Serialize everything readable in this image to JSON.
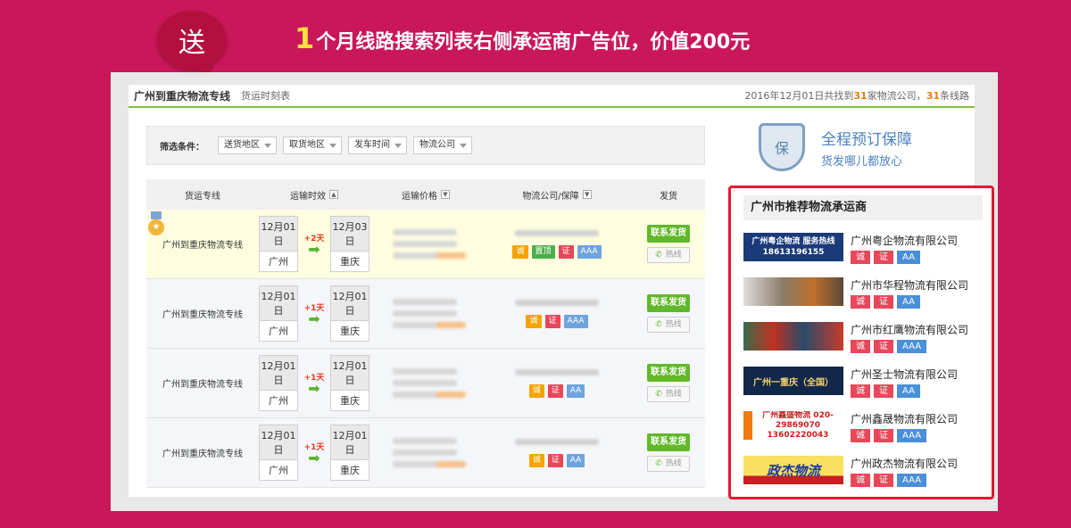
{
  "banner": {
    "badge": "送",
    "number": "1",
    "text": "个月线路搜索列表右侧承运商广告位，价值200元"
  },
  "topbar": {
    "route_title": "广州到重庆物流专线",
    "tab": "货运时刻表",
    "summary_prefix": "2016年12月01日共找到",
    "company_count": "31",
    "summary_mid": "家物流公司，",
    "line_count": "31",
    "summary_suffix": "条线路"
  },
  "filters": {
    "label": "筛选条件：",
    "items": [
      "送货地区",
      "取货地区",
      "发车时间",
      "物流公司"
    ]
  },
  "guarantee": {
    "line1": "全程预订保障",
    "line2": "货发哪儿都放心",
    "icon_char": "保"
  },
  "table": {
    "headers": [
      "货运专线",
      "运输时效",
      "运输价格",
      "物流公司/保障",
      "发货"
    ],
    "rows": [
      {
        "route": "广州到重庆物流专线",
        "depart_date": "12月01日",
        "depart_city": "广州",
        "days": "+2天",
        "arrive_date": "12月03日",
        "arrive_city": "重庆",
        "badges": [
          "诚",
          "置顶",
          "证",
          "AAA"
        ],
        "ship": "联系发货",
        "hotline": "热线"
      },
      {
        "route": "广州到重庆物流专线",
        "depart_date": "12月01日",
        "depart_city": "广州",
        "days": "+1天",
        "arrive_date": "12月01日",
        "arrive_city": "重庆",
        "badges": [
          "诚",
          "证",
          "AAA"
        ],
        "ship": "联系发货",
        "hotline": "热线"
      },
      {
        "route": "广州到重庆物流专线",
        "depart_date": "12月01日",
        "depart_city": "广州",
        "days": "+1天",
        "arrive_date": "12月01日",
        "arrive_city": "重庆",
        "badges": [
          "诚",
          "证",
          "AA"
        ],
        "ship": "联系发货",
        "hotline": "热线"
      },
      {
        "route": "广州到重庆物流专线",
        "depart_date": "12月01日",
        "depart_city": "广州",
        "days": "+1天",
        "arrive_date": "12月01日",
        "arrive_city": "重庆",
        "badges": [
          "诚",
          "证",
          "AA"
        ],
        "ship": "联系发货",
        "hotline": "热线"
      }
    ]
  },
  "sidebar": {
    "title": "广州市推荐物流承运商",
    "carriers": [
      {
        "name": "广州粤企物流有限公司",
        "thumb_text": "广州粤企物流 服务热线 18613196155",
        "badges": [
          "诚",
          "证",
          "AA"
        ]
      },
      {
        "name": "广州市华程物流有限公司",
        "thumb_text": "",
        "badges": [
          "诚",
          "证",
          "AA"
        ]
      },
      {
        "name": "广州市红鹰物流有限公司",
        "thumb_text": "",
        "badges": [
          "诚",
          "证",
          "AAA"
        ]
      },
      {
        "name": "广州圣士物流有限公司",
        "thumb_text": "广州一重庆（全国）",
        "badges": [
          "诚",
          "证",
          "AA"
        ]
      },
      {
        "name": "广州鑫晟物流有限公司",
        "thumb_text": "广州鑫盛物流 020-29869070 13602220043",
        "badges": [
          "诚",
          "证",
          "AAA"
        ]
      },
      {
        "name": "广州政杰物流有限公司",
        "thumb_text": "政杰物流",
        "badges": [
          "诚",
          "证",
          "AAA"
        ]
      }
    ]
  }
}
